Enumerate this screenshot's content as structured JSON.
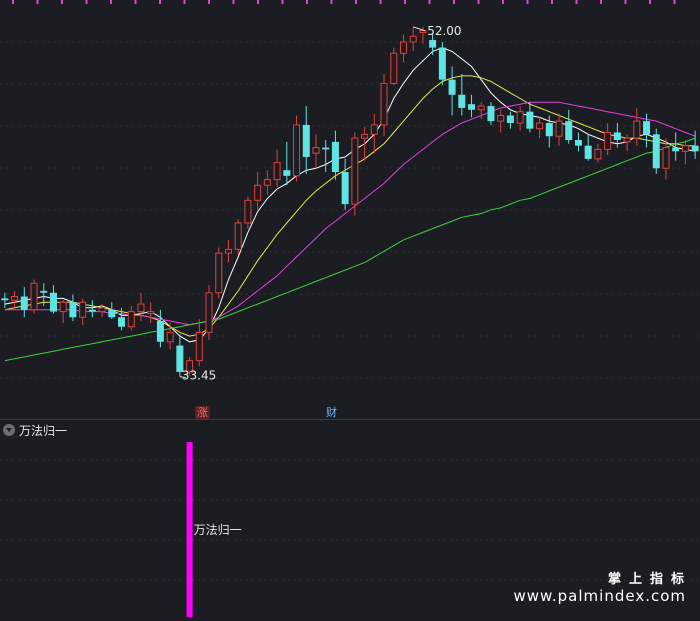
{
  "chart_data": [
    {
      "type": "candlestick",
      "title": "",
      "high_label": "52.00",
      "low_label": "33.45",
      "ylim": [
        32.0,
        53.0
      ],
      "grid": true,
      "colors": {
        "up": "#e0403a",
        "down": "#5fe3e3",
        "ma5": "#ffffff",
        "ma10": "#e8e84a",
        "ma20": "#e040e0",
        "ma60": "#3ad23a"
      },
      "series_ohlc": [
        [
          37.6,
          37.9,
          37.1,
          37.5
        ],
        [
          37.5,
          38.0,
          37.0,
          37.7
        ],
        [
          37.7,
          38.2,
          36.6,
          37.0
        ],
        [
          37.0,
          38.6,
          36.8,
          38.4
        ],
        [
          38.0,
          38.4,
          37.2,
          37.9
        ],
        [
          37.9,
          38.3,
          36.8,
          36.9
        ],
        [
          36.9,
          37.5,
          36.3,
          37.4
        ],
        [
          37.4,
          37.8,
          36.4,
          36.6
        ],
        [
          36.6,
          37.6,
          36.2,
          37.4
        ],
        [
          37.0,
          37.5,
          36.6,
          36.9
        ],
        [
          36.9,
          37.3,
          36.6,
          37.1
        ],
        [
          37.0,
          37.4,
          36.5,
          36.6
        ],
        [
          36.6,
          37.1,
          35.9,
          36.1
        ],
        [
          36.1,
          37.2,
          35.9,
          36.9
        ],
        [
          36.9,
          37.9,
          36.4,
          37.3
        ],
        [
          36.8,
          37.4,
          36.3,
          36.9
        ],
        [
          36.4,
          37.0,
          35.0,
          35.3
        ],
        [
          35.3,
          36.3,
          34.9,
          35.8
        ],
        [
          35.1,
          35.7,
          33.45,
          33.7
        ],
        [
          33.7,
          34.5,
          33.5,
          34.3
        ],
        [
          34.3,
          36.5,
          34.0,
          35.8
        ],
        [
          35.8,
          38.3,
          35.4,
          37.9
        ],
        [
          37.9,
          40.3,
          37.6,
          40.0
        ],
        [
          40.0,
          40.7,
          39.5,
          40.2
        ],
        [
          40.2,
          41.8,
          39.9,
          41.6
        ],
        [
          41.6,
          43.0,
          41.3,
          42.8
        ],
        [
          42.8,
          44.3,
          42.3,
          43.6
        ],
        [
          43.6,
          44.4,
          43.1,
          43.9
        ],
        [
          43.9,
          45.5,
          43.5,
          44.8
        ],
        [
          44.4,
          45.9,
          43.6,
          44.1
        ],
        [
          44.1,
          47.3,
          43.8,
          46.8
        ],
        [
          46.8,
          47.8,
          44.2,
          45.1
        ],
        [
          45.3,
          46.3,
          44.5,
          45.6
        ],
        [
          45.6,
          46.0,
          44.3,
          45.5
        ],
        [
          45.9,
          46.5,
          43.9,
          44.3
        ],
        [
          44.3,
          45.0,
          42.3,
          42.6
        ],
        [
          42.6,
          46.4,
          42.0,
          46.1
        ],
        [
          46.1,
          46.7,
          44.9,
          46.3
        ],
        [
          46.3,
          47.4,
          45.3,
          46.8
        ],
        [
          46.8,
          49.5,
          46.2,
          49.0
        ],
        [
          49.0,
          50.9,
          48.9,
          50.6
        ],
        [
          50.6,
          51.6,
          50.1,
          51.2
        ],
        [
          51.2,
          52.0,
          50.7,
          51.5
        ],
        [
          51.7,
          52.0,
          51.1,
          51.8
        ],
        [
          51.3,
          51.6,
          50.5,
          50.9
        ],
        [
          50.9,
          51.2,
          48.9,
          49.2
        ],
        [
          49.2,
          49.9,
          47.3,
          48.4
        ],
        [
          48.4,
          49.5,
          47.3,
          47.7
        ],
        [
          47.9,
          48.4,
          47.2,
          47.6
        ],
        [
          47.6,
          48.0,
          47.1,
          47.8
        ],
        [
          47.8,
          48.0,
          46.8,
          47.0
        ],
        [
          47.0,
          47.6,
          46.4,
          47.3
        ],
        [
          47.3,
          47.5,
          46.6,
          46.9
        ],
        [
          46.9,
          47.8,
          46.5,
          47.5
        ],
        [
          47.5,
          48.0,
          46.4,
          46.6
        ],
        [
          46.6,
          47.2,
          46.1,
          46.9
        ],
        [
          46.9,
          47.3,
          45.6,
          46.2
        ],
        [
          46.2,
          47.4,
          45.7,
          47.0
        ],
        [
          47.0,
          47.6,
          45.8,
          46.0
        ],
        [
          46.0,
          46.4,
          45.4,
          45.7
        ],
        [
          45.7,
          46.3,
          44.9,
          45.0
        ],
        [
          45.0,
          45.8,
          44.8,
          45.5
        ],
        [
          45.5,
          46.9,
          45.2,
          46.4
        ],
        [
          46.4,
          46.9,
          45.6,
          46.0
        ],
        [
          45.9,
          46.3,
          45.4,
          46.1
        ],
        [
          46.1,
          47.7,
          45.7,
          47.0
        ],
        [
          47.0,
          47.4,
          45.6,
          46.3
        ],
        [
          46.3,
          46.6,
          44.2,
          44.5
        ],
        [
          44.5,
          46.1,
          43.9,
          45.6
        ],
        [
          45.6,
          46.4,
          44.9,
          45.4
        ],
        [
          45.4,
          46.0,
          44.7,
          45.7
        ],
        [
          45.7,
          46.5,
          45.0,
          45.4
        ]
      ],
      "series_ma": [
        {
          "name": "",
          "key": "ma5",
          "values": [
            37.3,
            37.4,
            37.5,
            37.6,
            37.7,
            37.6,
            37.6,
            37.4,
            37.1,
            37.1,
            37.2,
            37.0,
            36.7,
            36.7,
            36.8,
            36.9,
            36.6,
            36.1,
            35.6,
            35.3,
            35.4,
            36.0,
            37.1,
            38.6,
            39.8,
            41.1,
            42.2,
            42.9,
            43.4,
            43.7,
            44.1,
            44.4,
            44.5,
            44.7,
            45.0,
            45.1,
            45.5,
            45.8,
            46.3,
            47.1,
            48.2,
            49.0,
            49.7,
            50.2,
            50.7,
            50.9,
            50.7,
            50.3,
            49.9,
            49.2,
            48.5,
            48.0,
            47.6,
            47.4,
            47.3,
            47.2,
            47.0,
            46.9,
            46.8,
            46.6,
            46.3,
            46.1,
            45.9,
            45.8,
            45.9,
            46.2,
            46.3,
            46.1,
            45.9,
            45.6,
            45.5,
            45.4
          ]
        },
        {
          "name": "",
          "key": "ma10",
          "values": [
            37.0,
            37.1,
            37.2,
            37.3,
            37.4,
            37.4,
            37.4,
            37.4,
            37.3,
            37.2,
            37.1,
            37.0,
            36.9,
            36.8,
            36.7,
            36.6,
            36.4,
            36.1,
            35.8,
            35.6,
            35.7,
            36.0,
            36.6,
            37.3,
            38.0,
            38.8,
            39.6,
            40.3,
            41.0,
            41.6,
            42.2,
            42.8,
            43.3,
            43.7,
            44.1,
            44.4,
            44.7,
            45.0,
            45.4,
            45.8,
            46.4,
            47.0,
            47.6,
            48.2,
            48.7,
            49.1,
            49.3,
            49.4,
            49.4,
            49.3,
            49.1,
            48.8,
            48.5,
            48.2,
            47.9,
            47.7,
            47.5,
            47.3,
            47.1,
            46.9,
            46.7,
            46.5,
            46.3,
            46.2,
            46.1,
            46.1,
            46.0,
            45.9,
            45.8,
            45.8,
            45.7,
            45.7
          ]
        },
        {
          "name": "",
          "key": "ma20",
          "values": [
            37.0,
            37.0,
            37.0,
            37.0,
            37.0,
            37.0,
            37.0,
            37.0,
            36.9,
            36.9,
            36.9,
            36.8,
            36.8,
            36.7,
            36.7,
            36.6,
            36.5,
            36.4,
            36.3,
            36.2,
            36.3,
            36.4,
            36.6,
            36.9,
            37.2,
            37.6,
            38.0,
            38.4,
            38.8,
            39.3,
            39.8,
            40.3,
            40.8,
            41.3,
            41.7,
            42.1,
            42.5,
            42.9,
            43.3,
            43.7,
            44.2,
            44.7,
            45.1,
            45.5,
            45.9,
            46.3,
            46.6,
            46.9,
            47.1,
            47.3,
            47.5,
            47.7,
            47.8,
            47.9,
            48.0,
            48.0,
            48.0,
            48.0,
            47.9,
            47.8,
            47.7,
            47.6,
            47.5,
            47.4,
            47.3,
            47.2,
            47.1,
            47.0,
            46.8,
            46.6,
            46.4,
            46.2
          ]
        },
        {
          "name": "",
          "key": "ma60",
          "values": [
            34.3,
            34.4,
            34.5,
            34.6,
            34.7,
            34.8,
            34.9,
            35.0,
            35.1,
            35.2,
            35.3,
            35.4,
            35.5,
            35.6,
            35.7,
            35.8,
            35.9,
            36.0,
            36.1,
            36.2,
            36.3,
            36.4,
            36.5,
            36.7,
            36.9,
            37.1,
            37.3,
            37.5,
            37.7,
            37.9,
            38.1,
            38.3,
            38.5,
            38.7,
            38.9,
            39.1,
            39.3,
            39.5,
            39.8,
            40.1,
            40.4,
            40.7,
            40.9,
            41.1,
            41.3,
            41.5,
            41.7,
            41.9,
            42.0,
            42.1,
            42.3,
            42.4,
            42.6,
            42.8,
            42.9,
            43.1,
            43.3,
            43.5,
            43.7,
            43.9,
            44.1,
            44.3,
            44.5,
            44.7,
            44.9,
            45.1,
            45.3,
            45.4,
            45.6,
            45.8,
            45.9,
            46.1
          ]
        }
      ]
    },
    {
      "type": "bar",
      "title": "万法归一",
      "bar_label": "万法归一",
      "signal_index": 19,
      "values": [
        1
      ],
      "ylim": [
        0,
        1
      ],
      "color": "#ff00ff"
    }
  ],
  "markers": {
    "zhang": "涨",
    "cai": "财"
  },
  "watermark": {
    "cn": "掌上指标",
    "url": "www.palmindex.com"
  },
  "top_marker_color": "#e040e0"
}
